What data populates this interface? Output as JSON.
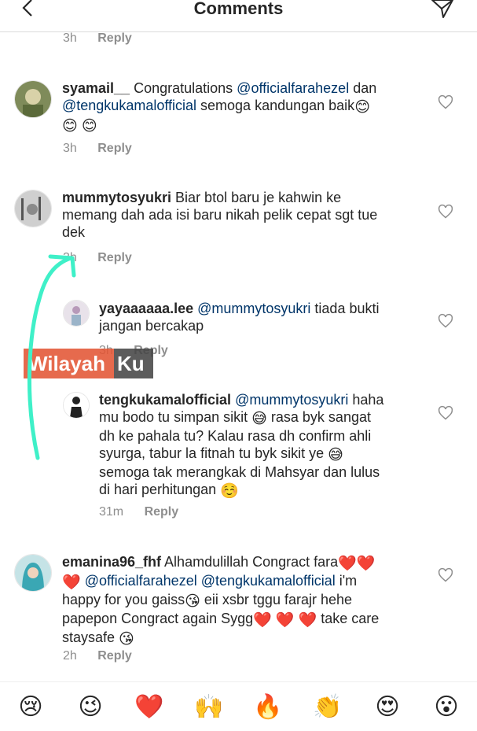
{
  "header": {
    "title": "Comments"
  },
  "top_meta": {
    "time": "3h",
    "reply": "Reply"
  },
  "comments": [
    {
      "user": "syamail__",
      "lines": [
        [
          {
            "t": "text",
            "v": " Congratulations "
          },
          {
            "t": "mention",
            "v": "@officialfarahezel"
          },
          {
            "t": "text",
            "v": " dan"
          }
        ],
        [
          {
            "t": "mention",
            "v": "@tengkukamalofficial"
          },
          {
            "t": "text",
            "v": "  semoga kandungan baik"
          },
          {
            "t": "emoji",
            "v": "😊"
          }
        ],
        [
          {
            "t": "emoji",
            "v": "😊"
          },
          {
            "t": "text",
            "v": " "
          },
          {
            "t": "emoji",
            "v": "😊"
          }
        ]
      ],
      "time": "3h",
      "reply": "Reply"
    },
    {
      "user": "mummytosyukri",
      "lines": [
        [
          {
            "t": "text",
            "v": " Biar btol baru je kahwin ke"
          }
        ],
        [
          {
            "t": "text",
            "v": "memang dah ada isi baru nikah pelik cepat sgt tue"
          }
        ],
        [
          {
            "t": "text",
            "v": "dek"
          }
        ]
      ],
      "time": "3h",
      "reply": "Reply"
    },
    {
      "user": "yayaaaaaa.lee",
      "lines": [
        [
          {
            "t": "text",
            "v": " "
          },
          {
            "t": "mention",
            "v": "@mummytosyukri"
          },
          {
            "t": "text",
            "v": " tiada bukti"
          }
        ],
        [
          {
            "t": "text",
            "v": "jangan bercakap"
          }
        ]
      ],
      "time": "3h",
      "reply": "Reply"
    },
    {
      "user": "tengkukamalofficial",
      "lines": [
        [
          {
            "t": "text",
            "v": " "
          },
          {
            "t": "mention",
            "v": "@mummytosyukri"
          },
          {
            "t": "text",
            "v": " haha"
          }
        ],
        [
          {
            "t": "text",
            "v": "mu bodo tu simpan sikit "
          },
          {
            "t": "emoji",
            "v": "😅"
          },
          {
            "t": "text",
            "v": " rasa byk sangat"
          }
        ],
        [
          {
            "t": "text",
            "v": "dh ke pahala tu? Kalau rasa dh confirm ahli"
          }
        ],
        [
          {
            "t": "text",
            "v": "syurga, tabur la fitnah tu byk sikit ye "
          },
          {
            "t": "emoji",
            "v": "😅"
          }
        ],
        [
          {
            "t": "text",
            "v": "semoga tak merangkak di Mahsyar dan lulus"
          }
        ],
        [
          {
            "t": "text",
            "v": "di hari perhitungan "
          },
          {
            "t": "emoji",
            "v": "☺️"
          }
        ]
      ],
      "time": "31m",
      "reply": "Reply"
    },
    {
      "user": "emanina96_fhf",
      "lines": [
        [
          {
            "t": "text",
            "v": " Alhamdulillah Congract fara"
          },
          {
            "t": "emoji",
            "v": "❤️"
          },
          {
            "t": "emoji",
            "v": "❤️"
          }
        ],
        [
          {
            "t": "emoji",
            "v": "❤️"
          },
          {
            "t": "text",
            "v": " "
          },
          {
            "t": "mention",
            "v": "@officialfarahezel"
          },
          {
            "t": "text",
            "v": " "
          },
          {
            "t": "mention",
            "v": "@tengkukamalofficial"
          },
          {
            "t": "text",
            "v": " i'm"
          }
        ],
        [
          {
            "t": "text",
            "v": "happy for you gaiss"
          },
          {
            "t": "emoji",
            "v": "😘"
          },
          {
            "t": "text",
            "v": " eii xsbr tggu farajr hehe"
          }
        ],
        [
          {
            "t": "text",
            "v": "papepon Congract again Sygg"
          },
          {
            "t": "emoji",
            "v": "❤️"
          },
          {
            "t": "text",
            "v": " "
          },
          {
            "t": "emoji",
            "v": "❤️"
          },
          {
            "t": "text",
            "v": " "
          },
          {
            "t": "emoji",
            "v": "❤️"
          },
          {
            "t": "text",
            "v": " take care"
          }
        ],
        [
          {
            "t": "text",
            "v": "staysafe "
          },
          {
            "t": "emoji",
            "v": "😘"
          }
        ]
      ],
      "time": "2h",
      "reply": "Reply"
    }
  ],
  "watermark": {
    "part1": "Wilayah",
    "part2": "Ku"
  },
  "emoji_bar": [
    "😢",
    "😉",
    "❤️",
    "🙌",
    "🔥",
    "👏",
    "😍",
    "😮"
  ],
  "icons": {
    "back": "chevron-left-icon",
    "send": "paper-plane-icon",
    "like": "heart-outline-icon"
  },
  "colors": {
    "mention": "#003569",
    "meta": "#8e8e8e",
    "arrow": "#3ff0c8"
  }
}
